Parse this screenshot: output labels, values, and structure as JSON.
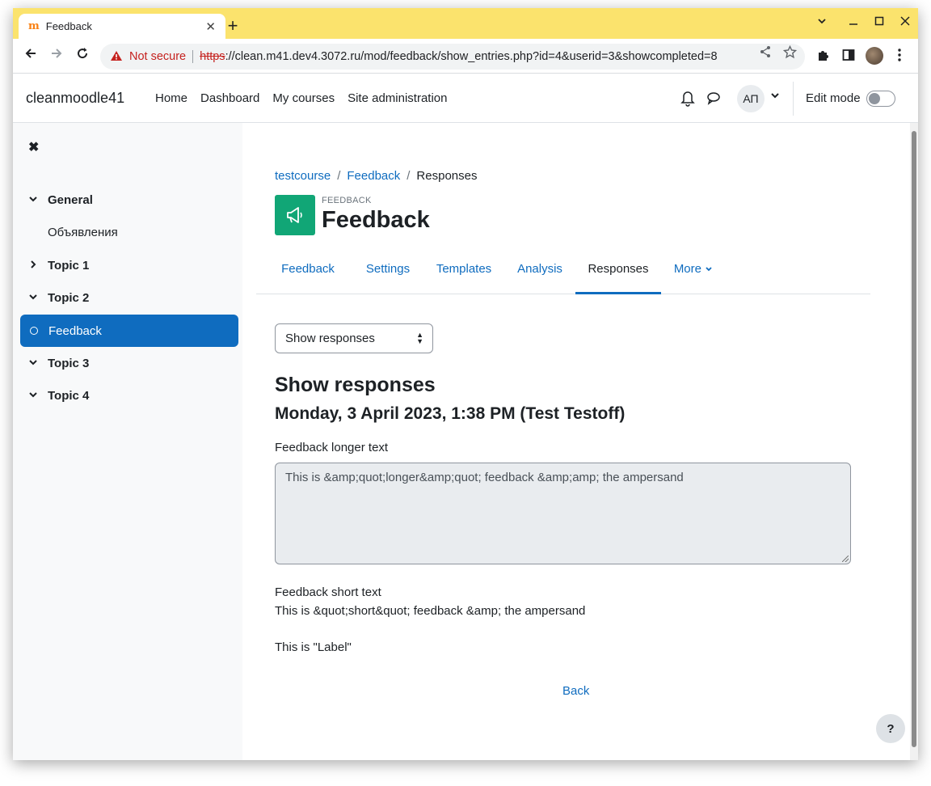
{
  "browser": {
    "tab_title": "Feedback",
    "tab_favicon": "m",
    "new_tab_glyph": "+",
    "close_glyph": "✕",
    "omnibox": {
      "not_secure": "Not secure",
      "scheme": "https",
      "url_rest": "://clean.m41.dev4.3072.ru/mod/feedback/show_entries.php?id=4&userid=3&showcompleted=8"
    }
  },
  "navbar": {
    "brand": "cleanmoodle41",
    "menu": [
      "Home",
      "Dashboard",
      "My courses",
      "Site administration"
    ],
    "avatar_initials": "АП",
    "edit_mode_label": "Edit mode"
  },
  "drawer": {
    "items": [
      {
        "label": "General",
        "type": "section",
        "expanded": true
      },
      {
        "label": "Объявления",
        "type": "activity"
      },
      {
        "label": "Topic 1",
        "type": "section",
        "expanded": false
      },
      {
        "label": "Topic 2",
        "type": "section",
        "expanded": true
      },
      {
        "label": "Feedback",
        "type": "activity",
        "active": true
      },
      {
        "label": "Topic 3",
        "type": "section",
        "expanded": true
      },
      {
        "label": "Topic 4",
        "type": "section",
        "expanded": true
      }
    ]
  },
  "breadcrumb": {
    "items": [
      "testcourse",
      "Feedback",
      "Responses"
    ],
    "separator": "/"
  },
  "module": {
    "type_label": "FEEDBACK",
    "title": "Feedback",
    "icon": "megaphone-icon",
    "icon_color": "#11a676"
  },
  "tabs": {
    "items": [
      "Feedback",
      "Settings",
      "Templates",
      "Analysis",
      "Responses",
      "More"
    ],
    "active": "Responses"
  },
  "select": {
    "value": "Show responses"
  },
  "content": {
    "heading": "Show responses",
    "subheading": "Monday, 3 April 2023, 1:38 PM (Test Testoff)",
    "q1_label": "Feedback longer text",
    "q1_value": "This is &amp;quot;longer&amp;quot; feedback &amp;amp; the ampersand",
    "q2_label": "Feedback short text",
    "q2_value": "This is &quot;short&quot; feedback &amp; the ampersand",
    "label_text": "This is \"Label\"",
    "back": "Back"
  },
  "help": {
    "label": "?"
  },
  "colors": {
    "accent": "#0f6cbf",
    "chrome_tabbar": "#fbe36d",
    "warning": "#c5221f"
  }
}
